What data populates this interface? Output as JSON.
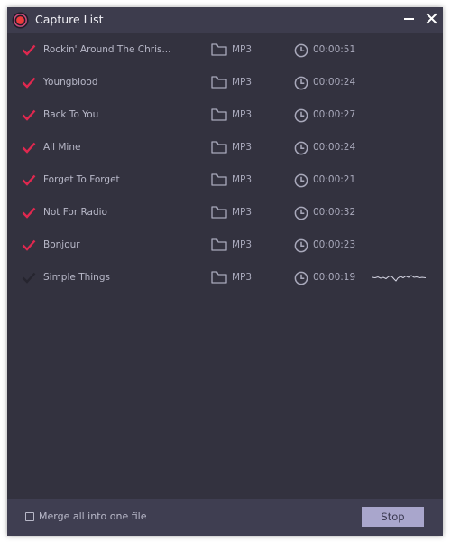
{
  "window": {
    "title": "Capture List",
    "minimize_label": "minimize",
    "close_label": "close"
  },
  "colors": {
    "accent": "#e0284f",
    "pending_check": "#26252f",
    "background": "#33323f",
    "titlebar": "#3d3c4d",
    "footer": "#3f3e51",
    "button": "#a9a6cc"
  },
  "tracks": [
    {
      "name": "Rockin' Around The Chris...",
      "format": "MP3",
      "duration": "00:00:51",
      "checked": true,
      "recording": false
    },
    {
      "name": "Youngblood",
      "format": "MP3",
      "duration": "00:00:24",
      "checked": true,
      "recording": false
    },
    {
      "name": "Back To You",
      "format": "MP3",
      "duration": "00:00:27",
      "checked": true,
      "recording": false
    },
    {
      "name": "All Mine",
      "format": "MP3",
      "duration": "00:00:24",
      "checked": true,
      "recording": false
    },
    {
      "name": "Forget To Forget",
      "format": "MP3",
      "duration": "00:00:21",
      "checked": true,
      "recording": false
    },
    {
      "name": "Not For Radio",
      "format": "MP3",
      "duration": "00:00:32",
      "checked": true,
      "recording": false
    },
    {
      "name": "Bonjour",
      "format": "MP3",
      "duration": "00:00:23",
      "checked": true,
      "recording": false
    },
    {
      "name": "Simple Things",
      "format": "MP3",
      "duration": "00:00:19",
      "checked": false,
      "recording": true
    }
  ],
  "footer": {
    "merge_label": "Merge all into one file",
    "merge_checked": false,
    "stop_label": "Stop"
  }
}
